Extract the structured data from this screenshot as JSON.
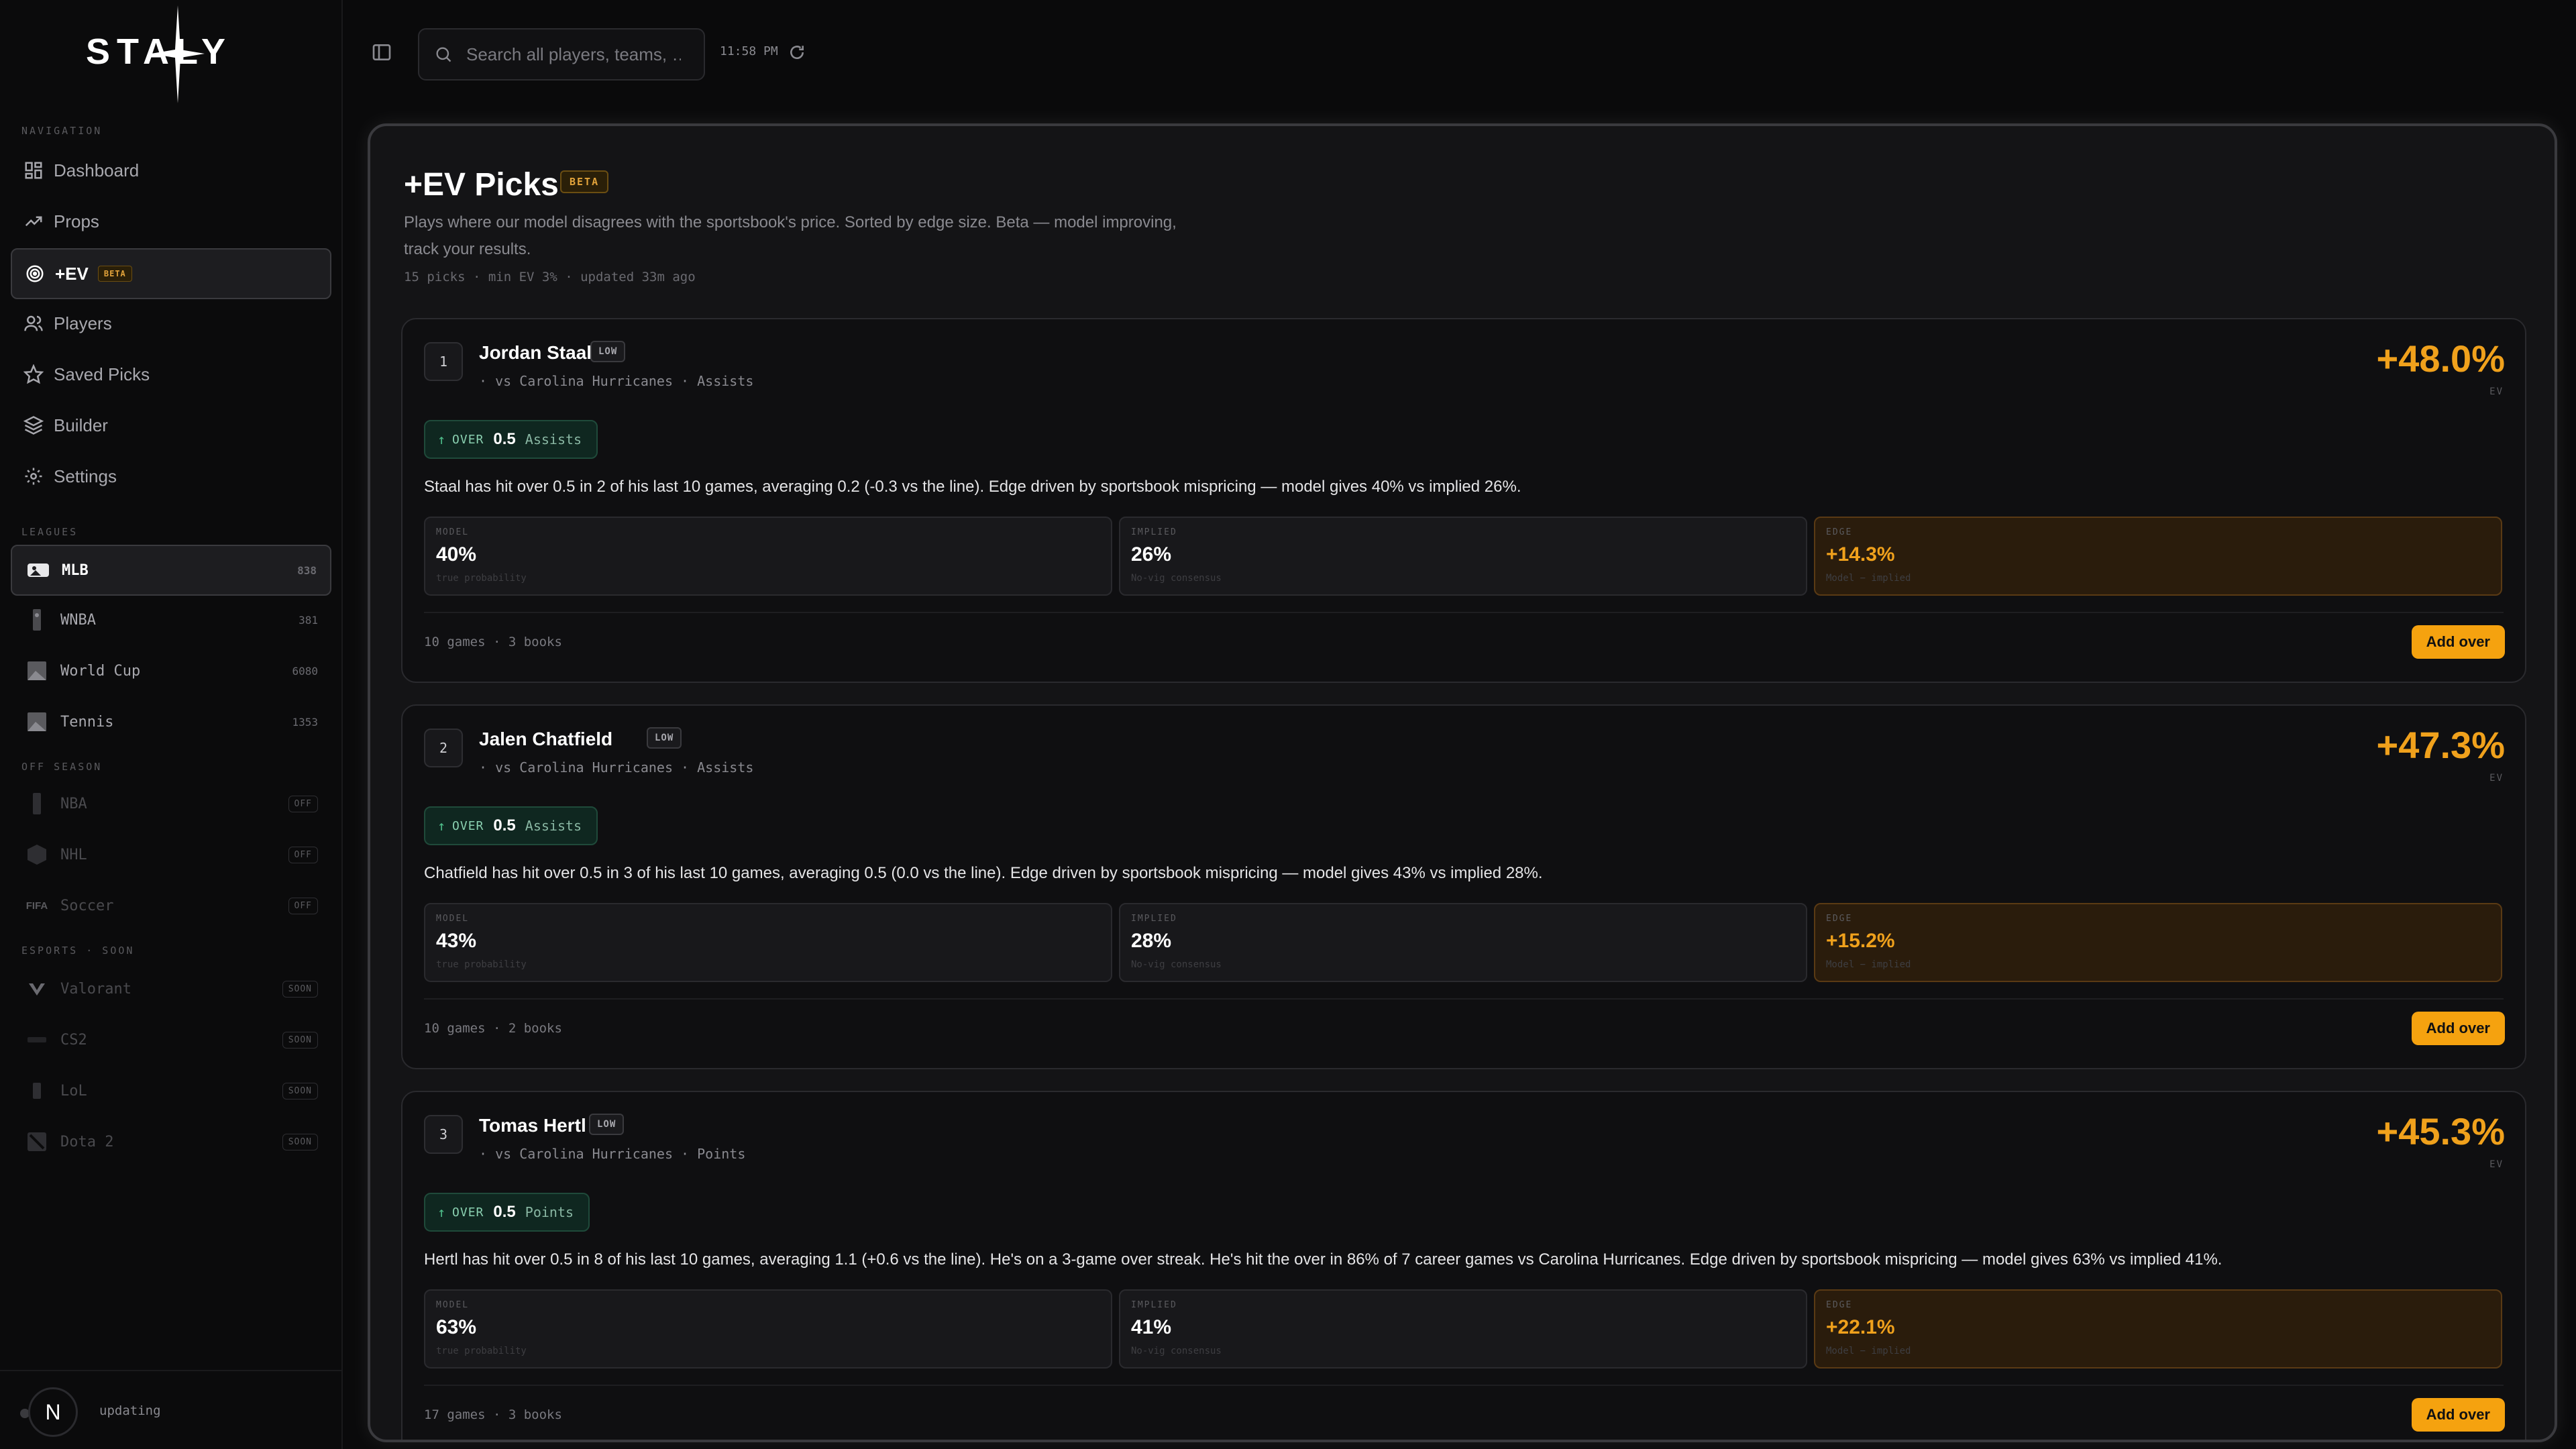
{
  "app": {
    "logo_text": "STALY"
  },
  "topbar": {
    "search_placeholder": "Search all players, teams, …",
    "time": "11:58 PM"
  },
  "sidebar": {
    "nav_label": "NAVIGATION",
    "nav": [
      {
        "label": "Dashboard",
        "icon": "dashboard-icon"
      },
      {
        "label": "Props",
        "icon": "trending-icon"
      },
      {
        "label": "+EV",
        "icon": "target-icon",
        "badge": "BETA",
        "active": true
      },
      {
        "label": "Players",
        "icon": "users-icon"
      },
      {
        "label": "Saved Picks",
        "icon": "star-icon"
      },
      {
        "label": "Builder",
        "icon": "layers-icon"
      },
      {
        "label": "Settings",
        "icon": "gear-icon"
      }
    ],
    "leagues_label": "LEAGUES",
    "leagues": [
      {
        "label": "MLB",
        "count": "838",
        "active": true
      },
      {
        "label": "WNBA",
        "count": "381"
      },
      {
        "label": "World Cup",
        "count": "6080"
      },
      {
        "label": "Tennis",
        "count": "1353"
      }
    ],
    "offseason_label": "OFF SEASON",
    "offseason": [
      {
        "label": "NBA",
        "badge": "OFF"
      },
      {
        "label": "NHL",
        "badge": "OFF"
      },
      {
        "label": "Soccer",
        "badge": "OFF"
      }
    ],
    "esports_label": "ESPORTS · SOON",
    "esports": [
      {
        "label": "Valorant",
        "badge": "SOON"
      },
      {
        "label": "CS2",
        "badge": "SOON"
      },
      {
        "label": "LoL",
        "badge": "SOON"
      },
      {
        "label": "Dota 2",
        "badge": "SOON"
      }
    ],
    "status": {
      "avatar_letter": "N",
      "text": "updating"
    }
  },
  "page": {
    "title": "+EV Picks",
    "badge": "BETA",
    "description": "Plays where our model disagrees with the sportsbook's price. Sorted by edge size. Beta — model improving, track your results.",
    "meta": "15 picks · min EV 3% · updated 33m ago"
  },
  "picks": [
    {
      "rank": "1",
      "player": "Jordan Staal",
      "confidence": "LOW",
      "matchup": "· vs Carolina Hurricanes · Assists",
      "ev": "+48.0%",
      "ev_label": "EV",
      "side": "OVER",
      "line": "0.5",
      "stat": "Assists",
      "analysis": "Staal has hit over 0.5 in 2 of his last 10 games, averaging 0.2 (-0.3 vs the line). Edge driven by sportsbook mispricing — model gives 40% vs implied 26%.",
      "model": {
        "label": "MODEL",
        "value": "40%",
        "sub": "true probability"
      },
      "implied": {
        "label": "IMPLIED",
        "value": "26%",
        "sub": "No-vig consensus"
      },
      "edge": {
        "label": "EDGE",
        "value": "+14.3%",
        "sub": "Model − implied"
      },
      "meta": "10 games · 3 books",
      "button": "Add over"
    },
    {
      "rank": "2",
      "player": "Jalen Chatfield",
      "confidence": "LOW",
      "matchup": "· vs Carolina Hurricanes · Assists",
      "ev": "+47.3%",
      "ev_label": "EV",
      "side": "OVER",
      "line": "0.5",
      "stat": "Assists",
      "analysis": "Chatfield has hit over 0.5 in 3 of his last 10 games, averaging 0.5 (0.0 vs the line). Edge driven by sportsbook mispricing — model gives 43% vs implied 28%.",
      "model": {
        "label": "MODEL",
        "value": "43%",
        "sub": "true probability"
      },
      "implied": {
        "label": "IMPLIED",
        "value": "28%",
        "sub": "No-vig consensus"
      },
      "edge": {
        "label": "EDGE",
        "value": "+15.2%",
        "sub": "Model − implied"
      },
      "meta": "10 games · 2 books",
      "button": "Add over"
    },
    {
      "rank": "3",
      "player": "Tomas Hertl",
      "confidence": "LOW",
      "matchup": "· vs Carolina Hurricanes · Points",
      "ev": "+45.3%",
      "ev_label": "EV",
      "side": "OVER",
      "line": "0.5",
      "stat": "Points",
      "analysis": "Hertl has hit over 0.5 in 8 of his last 10 games, averaging 1.1 (+0.6 vs the line). He's on a 3-game over streak. He's hit the over in 86% of 7 career games vs Carolina Hurricanes. Edge driven by sportsbook mispricing — model gives 63% vs implied 41%.",
      "model": {
        "label": "MODEL",
        "value": "63%",
        "sub": "true probability"
      },
      "implied": {
        "label": "IMPLIED",
        "value": "41%",
        "sub": "No-vig consensus"
      },
      "edge": {
        "label": "EDGE",
        "value": "+22.1%",
        "sub": "Model − implied"
      },
      "meta": "17 games · 3 books",
      "button": "Add over"
    }
  ],
  "colors": {
    "accent": "#f5a20f",
    "ev": "#f0a11c",
    "pick_green": "#4fbf8b",
    "background": "#0a0a0b"
  }
}
